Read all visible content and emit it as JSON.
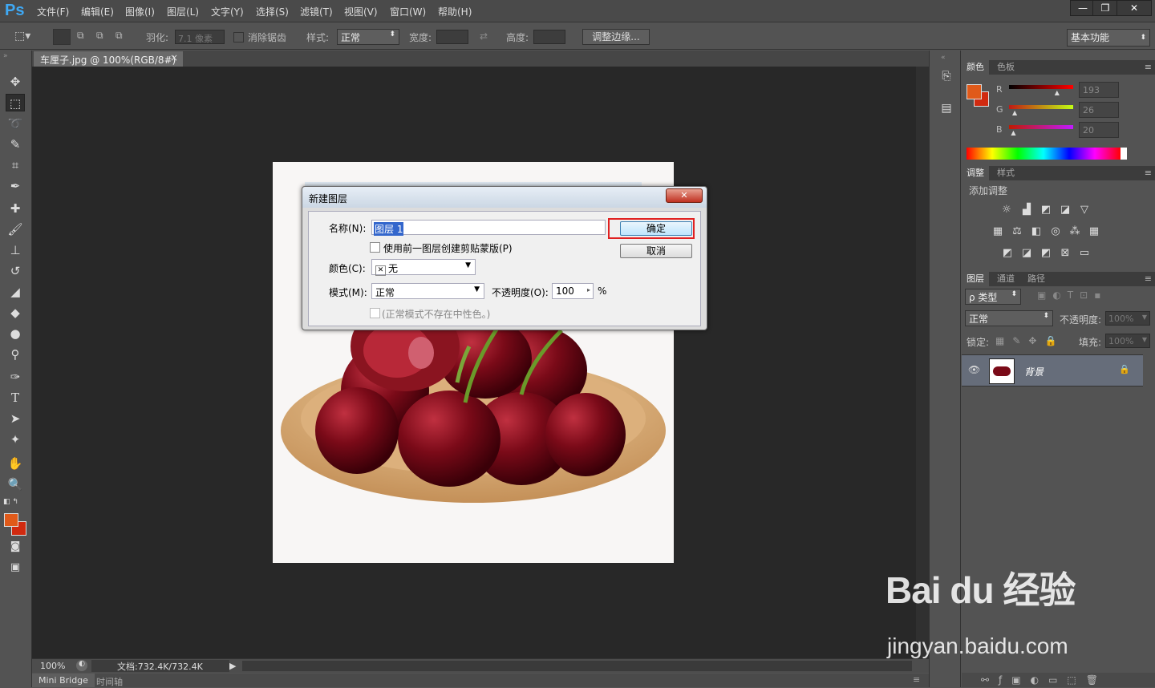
{
  "app": {
    "logo": "Ps",
    "window_controls": [
      "—",
      "❐",
      "✕"
    ]
  },
  "menubar": [
    "文件(F)",
    "编辑(E)",
    "图像(I)",
    "图层(L)",
    "文字(Y)",
    "选择(S)",
    "滤镜(T)",
    "视图(V)",
    "窗口(W)",
    "帮助(H)"
  ],
  "options": {
    "feather_label": "羽化:",
    "feather_value": "7.1 像素",
    "antialias_label": "消除锯齿",
    "style_label": "样式:",
    "style_value": "正常",
    "width_label": "宽度:",
    "height_label": "高度:",
    "refine_edge": "调整边缘...",
    "workspace": "基本功能"
  },
  "document": {
    "tab_title": "车厘子.jpg @ 100%(RGB/8#)",
    "tab_close": "×"
  },
  "status": {
    "zoom": "100%",
    "doc_info": "文档:732.4K/732.4K"
  },
  "bottom_tabs": [
    "Mini Bridge",
    "时间轴"
  ],
  "color_panel": {
    "tabs": [
      "颜色",
      "色板"
    ],
    "foreground": "#e05a1a",
    "background": "#d02a10",
    "channels": [
      {
        "label": "R",
        "value": "193"
      },
      {
        "label": "G",
        "value": "26"
      },
      {
        "label": "B",
        "value": "20"
      }
    ],
    "channel_levels": [
      0.76,
      0.1,
      0.08
    ]
  },
  "adjust_panel": {
    "tabs": [
      "调整",
      "样式"
    ],
    "title": "添加调整"
  },
  "layers_panel": {
    "tabs": [
      "图层",
      "通道",
      "路径"
    ],
    "kind": "ρ 类型",
    "blend": "正常",
    "opacity_label": "不透明度:",
    "opacity_value": "100%",
    "lock_label": "锁定:",
    "fill_label": "填充:",
    "fill_value": "100%",
    "layer_name": "背景"
  },
  "dialog": {
    "title": "新建图层",
    "close": "✕",
    "name_label": "名称(N):",
    "name_value": "图层 1",
    "clip_label": "使用前一图层创建剪贴蒙版(P)",
    "color_label": "颜色(C):",
    "color_value": "无",
    "mode_label": "模式(M):",
    "mode_value": "正常",
    "opacity_label": "不透明度(O):",
    "opacity_value": "100",
    "opacity_unit": "%",
    "neutral_label": "(正常模式不存在中性色。)",
    "ok": "确定",
    "cancel": "取消"
  },
  "watermark": {
    "brand": "Bai du 经验",
    "url": "jingyan.baidu.com"
  },
  "colors": {
    "highlight_box": "#e02020",
    "arrow": "#e02020",
    "selected_text_bg": "#3366cc"
  }
}
